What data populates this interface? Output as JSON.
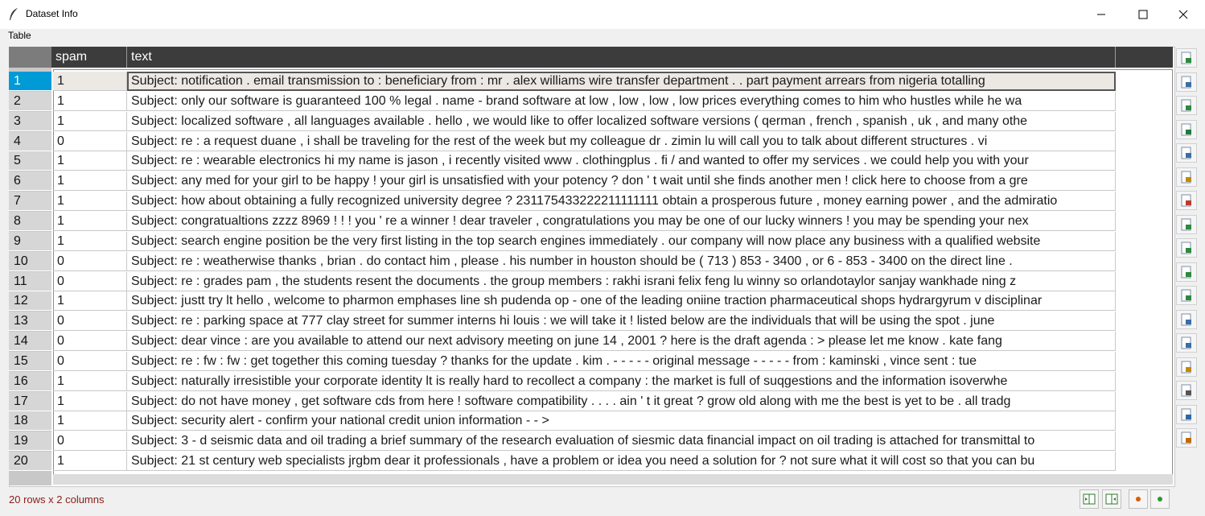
{
  "window": {
    "title": "Dataset Info"
  },
  "menu": {
    "items": [
      "Table"
    ]
  },
  "table": {
    "columns": [
      "spam",
      "text"
    ],
    "rows": [
      {
        "num": "1",
        "spam": "1",
        "text": "Subject: notification .  email transmission  to : beneficiary  from : mr . alex williams  wire transfer department . .  part payment arrears from nigeria  totalling"
      },
      {
        "num": "2",
        "spam": "1",
        "text": "Subject: only our software is guaranteed 100 % legal .  name - brand software at low , low , low , low prices  everything comes to him who hustles while he wa"
      },
      {
        "num": "3",
        "spam": "1",
        "text": "Subject: localized software , all languages available .  hello , we would like to offer localized software versions ( qerman , french , spanish , uk , and many othe"
      },
      {
        "num": "4",
        "spam": "0",
        "text": "Subject: re : a request  duane ,  i shall be traveling for the rest of the week but my colleague  dr . zimin lu will call you to talk about different  structures .  vi"
      },
      {
        "num": "5",
        "spam": "1",
        "text": "Subject: re : wearable electronics  hi my name is jason , i recently visited www . clothingplus . fi / and wanted to offer my services . we could help you with your"
      },
      {
        "num": "6",
        "spam": "1",
        "text": "Subject: any med for your girl to be happy !  your girl is unsatisfied with your potency ? don ' t wait until she finds another men !  click here to choose from a gre"
      },
      {
        "num": "7",
        "spam": "1",
        "text": "Subject: how about obtaining a fully recognized university degree ? 231175433222211111111  obtain a prosperous future , money earning power ,  and the admiratio"
      },
      {
        "num": "8",
        "spam": "1",
        "text": "Subject: congratualtions zzzz 8969 ! ! !  you ' re  a winner !  dear traveler ,  congratulations  you may be one of our lucky winners !  you may be spending  your nex"
      },
      {
        "num": "9",
        "spam": "1",
        "text": "Subject: search engine position  be the very first listing in the top search engines immediately .  our company will now place any business with a qualified website"
      },
      {
        "num": "10",
        "spam": "0",
        "text": "Subject: re : weatherwise  thanks , brian . do contact him , please . his number in houston should be  ( 713 ) 853 - 3400 , or 6 - 853 - 3400 on the direct line ."
      },
      {
        "num": "11",
        "spam": "0",
        "text": "Subject: re : grades  pam ,  the students resent the documents .  the group members :  rakhi israni  felix feng lu  winny so  orlandotaylor  sanjay wankhade  ning z"
      },
      {
        "num": "12",
        "spam": "1",
        "text": "Subject: justt try lt  hello , welcome to pharmon emphases line sh pudenda op  - one of the leading oniine traction pharmaceutical shops  hydrargyrum v  disciplinar"
      },
      {
        "num": "13",
        "spam": "0",
        "text": "Subject: re : parking space at 777 clay street for summer interns  hi louis :  we will take it !  listed below are the individuals that will be using the spot .  june"
      },
      {
        "num": "14",
        "spam": "0",
        "text": "Subject: dear vince :  are you available to attend our next advisory meeting on june 14 , 2001 ?  here is the draft agenda :  >  please let me know .  kate fang"
      },
      {
        "num": "15",
        "spam": "0",
        "text": "Subject: re : fw : fw : get together this coming tuesday ?  thanks for the update . kim .  - - - - - original message - - - - -  from : kaminski , vince  sent : tue"
      },
      {
        "num": "16",
        "spam": "1",
        "text": "Subject: naturally irresistible your corporate identity  lt is really hard to recollect a company : the  market is full of suqgestions and the information isoverwhe"
      },
      {
        "num": "17",
        "spam": "1",
        "text": "Subject: do not have money , get software cds from here !  software compatibility . . . . ain ' t it great ?  grow old along with me the best is yet to be .  all tradg"
      },
      {
        "num": "18",
        "spam": "1",
        "text": "Subject: security alert - confirm your national credit union information  - - >"
      },
      {
        "num": "19",
        "spam": "0",
        "text": "Subject: 3 - d seismic data and oil trading  a brief summary of the research evaluation of siesmic data financial impact  on oil trading is attached for transmittal to"
      },
      {
        "num": "20",
        "spam": "1",
        "text": "Subject: 21 st century web specialists jrgbm  dear  it professionals ,  have a problem or idea you need a solution for ?  not sure what it will cost so that you can bu"
      }
    ]
  },
  "status": {
    "text": "20 rows x 2 columns"
  },
  "toolbar": {
    "icons": [
      "save-icon",
      "load-icon",
      "import-icon",
      "export-excel-icon",
      "copy-icon",
      "paste-icon",
      "plot-icon",
      "transpose-icon",
      "aggregate-icon",
      "pivot-icon",
      "melt-icon",
      "merge-icon",
      "query-icon",
      "clean-icon",
      "stats-icon",
      "summary-icon",
      "settings-icon"
    ]
  },
  "colors": {
    "header_bg": "#3c3c3c",
    "selected_row_header": "#009ad6",
    "status_text": "#8a1b1b"
  }
}
